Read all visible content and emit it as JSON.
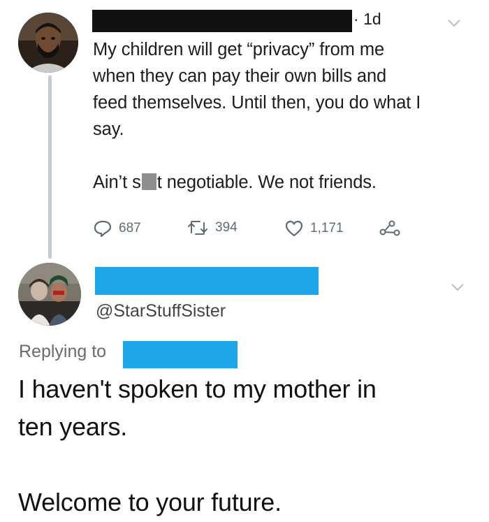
{
  "tweet": {
    "time": "1d",
    "lines": [
      "My children will get “privacy” from me",
      "when they can pay their own bills and",
      "feed themselves. Until then, you do what I",
      "say."
    ],
    "line2_before": "Ain’t s",
    "line2_after": "t negotiable. We not friends.",
    "actions": {
      "replies": "687",
      "retweets": "394",
      "likes": "1,171"
    }
  },
  "reply": {
    "handle": "@StarStuffSister",
    "replying_label": "Replying to",
    "lines": [
      "I haven't spoken to my mother in",
      "ten years."
    ],
    "closing": "Welcome to your future."
  },
  "colors": {
    "redaction_black": "#111111",
    "redaction_blue": "#1ea6ea",
    "thread_line": "#c4ccd3",
    "icon_gray": "#5f6b74"
  },
  "icons": [
    "reply-icon",
    "retweet-icon",
    "like-icon",
    "share-icon",
    "chevron-down-icon"
  ]
}
